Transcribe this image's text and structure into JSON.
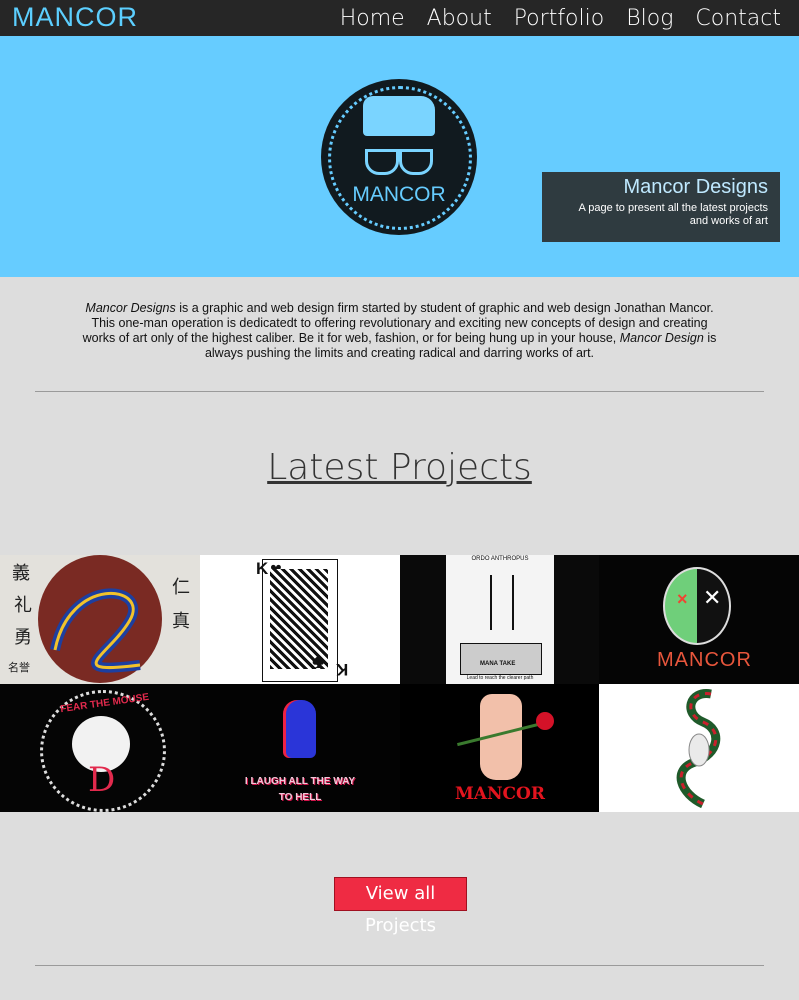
{
  "nav": {
    "logo": "MANCOR",
    "items": [
      "Home",
      "About",
      "Portfolio",
      "Blog",
      "Contact"
    ]
  },
  "hero": {
    "badge_text": "MANCOR",
    "info_title": "Mancor Designs",
    "info_text": "A page to present all the latest projects and works of art"
  },
  "intro": {
    "brand": "Mancor Designs",
    "part1": " is a graphic and web design firm started by student of graphic and web design Jonathan Mancor. This one-man operation is dedicatedt to offering revolutionary and exciting new concepts of design and creating works of art only of the highest caliber. Be it for web, fashion, or for being hung up in your house, ",
    "brand2": "Mancor Design",
    "part2": " is always pushing the limits and creating radical and darring works of art."
  },
  "projects": {
    "title": "Latest Projects",
    "tile_texts": {
      "dragon_kanji": [
        "義",
        "礼",
        "勇",
        "仁",
        "真",
        "名誉"
      ],
      "card": "K",
      "poster_header": "ORDO ANTHROPUS",
      "poster_label": "MANA TAKE",
      "poster_footer": "Lead to reach the clearer path",
      "mancor_logo": "MANCOR",
      "mouse": "FEAR THE MOUSE",
      "laugh_line1": "I LAUGH ALL THE WAY",
      "laugh_line2": "TO HELL",
      "rose_logo": "MANCOR"
    }
  },
  "cta": "View all Projects",
  "colors": {
    "nav_bg": "#262626",
    "accent": "#66ccff",
    "page_bg": "#dddddd",
    "button": "#ef2b43"
  }
}
